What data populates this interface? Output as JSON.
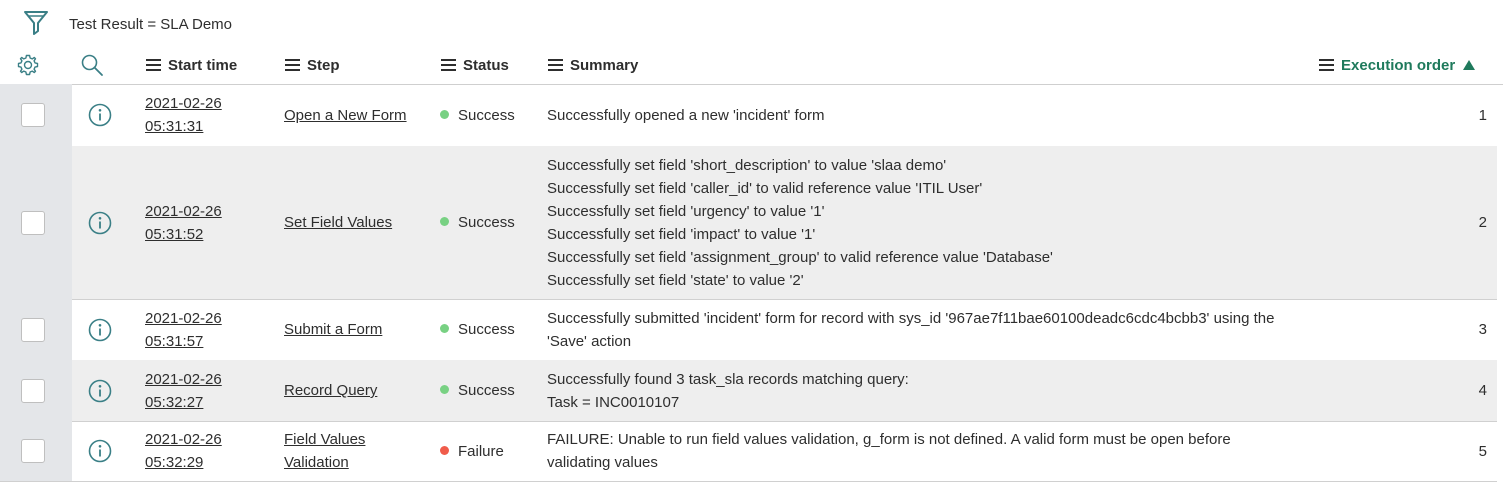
{
  "filter": {
    "text": "Test Result = SLA Demo",
    "icon": "funnel-icon"
  },
  "header": {
    "icons": {
      "settings": "gear-icon",
      "search": "search-icon"
    },
    "columns": {
      "start_time": "Start time",
      "step": "Step",
      "status": "Status",
      "summary": "Summary",
      "execution_order": "Execution order"
    },
    "sort": {
      "column": "Execution order",
      "direction": "ascending"
    }
  },
  "colors": {
    "success": "#78d183",
    "failure": "#f05c4b",
    "accent": "#1f7a5c"
  },
  "rows": [
    {
      "date": "2021-02-26",
      "time": "05:31:31",
      "step": [
        "Open a New Form"
      ],
      "status": "Success",
      "summary": [
        "Successfully opened a new 'incident' form"
      ],
      "order": "1"
    },
    {
      "date": "2021-02-26",
      "time": "05:31:52",
      "step": [
        "Set Field Values"
      ],
      "status": "Success",
      "summary": [
        "Successfully set field 'short_description' to value 'slaa demo'",
        "Successfully set field 'caller_id' to valid reference value 'ITIL User'",
        "Successfully set field 'urgency' to value '1'",
        "Successfully set field 'impact' to value '1'",
        "Successfully set field 'assignment_group' to valid reference value 'Database'",
        "Successfully set field 'state' to value '2'"
      ],
      "order": "2"
    },
    {
      "date": "2021-02-26",
      "time": "05:31:57",
      "step": [
        "Submit a Form"
      ],
      "status": "Success",
      "summary": [
        "Successfully submitted 'incident' form for record with sys_id '967ae7f11bae60100deadc6cdc4bcbb3' using the",
        "'Save' action"
      ],
      "order": "3"
    },
    {
      "date": "2021-02-26",
      "time": "05:32:27",
      "step": [
        "Record Query"
      ],
      "status": "Success",
      "summary": [
        "Successfully found 3 task_sla records matching query:",
        "Task = INC0010107"
      ],
      "order": "4"
    },
    {
      "date": "2021-02-26",
      "time": "05:32:29",
      "step": [
        "Field Values",
        "Validation"
      ],
      "status": "Failure",
      "summary": [
        "FAILURE: Unable to run field values validation, g_form is not defined. A valid form must be open before",
        "validating values"
      ],
      "order": "5"
    }
  ]
}
